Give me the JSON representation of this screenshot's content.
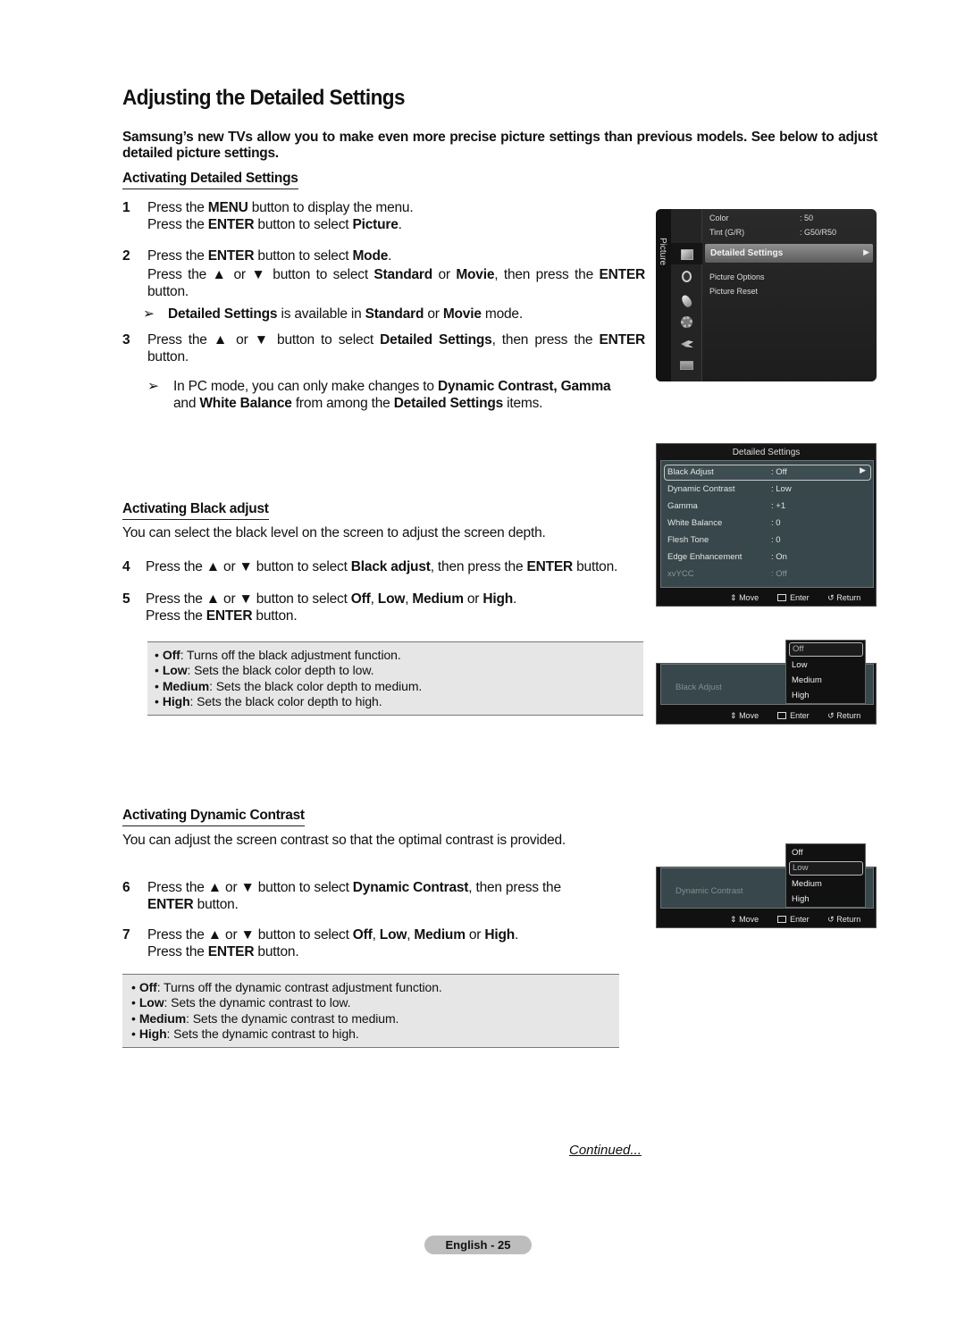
{
  "page": {
    "title": "Adjusting the Detailed Settings",
    "intro": "Samsung’s new TVs allow you to make even more precise picture settings than previous models. See below to adjust detailed picture settings.",
    "continued": "Continued...",
    "page_label": "English - 25"
  },
  "section1": {
    "heading": "Activating Detailed Settings",
    "step1": {
      "num": "1",
      "a": "Press the ",
      "b": "MENU",
      "c": " button to display the menu.",
      "d": "Press the ",
      "e": "ENTER",
      "f": " button to select ",
      "g": "Picture",
      "h": "."
    },
    "step2": {
      "num": "2",
      "a": "Press the ",
      "b": "ENTER",
      "c": " button to select ",
      "d": "Mode",
      "e": ".",
      "f": "Press the ▲ or ▼ button to select ",
      "g": "Standard",
      "h": " or ",
      "i": "Movie",
      "j": ", then press the ",
      "k": "ENTER",
      "l": " button."
    },
    "note1": {
      "arrow": "➢",
      "a": "Detailed Settings",
      "b": " is available in ",
      "c": "Standard",
      "d": " or ",
      "e": "Movie",
      "f": " mode."
    },
    "step3": {
      "num": "3",
      "a": "Press the ▲ or ▼ button to select ",
      "b": "Detailed Settings",
      "c": ", then press the ",
      "d": "ENTER",
      "e": " button."
    },
    "note2": {
      "arrow": "➢",
      "a": "In PC mode, you can only make changes to ",
      "b": "Dynamic Contrast, Gamma",
      "c": "and ",
      "d": "White Balance",
      "e": " from among the ",
      "f": "Detailed Settings",
      "g": " items."
    }
  },
  "section2": {
    "heading": "Activating Black adjust",
    "desc": "You can select the black level on the screen to adjust the screen depth.",
    "step4": {
      "num": "4",
      "a": "Press the ▲ or ▼ button to select ",
      "b": "Black adjust",
      "c": ", then press the ",
      "d": "ENTER",
      "e": " button."
    },
    "step5": {
      "num": "5",
      "a": "Press the ▲ or ▼ button to select ",
      "b": "Off",
      "c": ", ",
      "d": "Low",
      "e": ", ",
      "f": "Medium",
      "g": " or ",
      "h": "High",
      "i": ".",
      "j": "Press the ",
      "k": "ENTER",
      "l": " button."
    },
    "options": [
      {
        "name": "Off",
        "desc": ": Turns off the black adjustment function."
      },
      {
        "name": "Low",
        "desc": ": Sets the black color depth to low."
      },
      {
        "name": "Medium",
        "desc": ": Sets the black color depth to medium."
      },
      {
        "name": "High",
        "desc": ": Sets the black color depth to high."
      }
    ]
  },
  "section3": {
    "heading": "Activating Dynamic Contrast",
    "desc": "You can adjust the screen contrast so that the optimal contrast is provided.",
    "step6": {
      "num": "6",
      "a": "Press the ▲ or ▼ button to select ",
      "b": "Dynamic Contrast",
      "c": ", then press the",
      "d": "ENTER",
      "e": " button."
    },
    "step7": {
      "num": "7",
      "a": "Press the ▲ or ▼ button to select ",
      "b": "Off",
      "c": ", ",
      "d": "Low",
      "e": ", ",
      "f": "Medium",
      "g": " or ",
      "h": "High",
      "i": ".",
      "j": "Press the ",
      "k": "ENTER",
      "l": " button."
    },
    "options": [
      {
        "name": "Off",
        "desc": ": Turns off the dynamic contrast adjustment function."
      },
      {
        "name": "Low",
        "desc": ": Sets the dynamic contrast to low."
      },
      {
        "name": "Medium",
        "desc": ": Sets the dynamic contrast to medium."
      },
      {
        "name": "High",
        "desc": ": Sets the dynamic contrast to high."
      }
    ]
  },
  "osd_picture_menu": {
    "tab_label": "Picture",
    "icons": [
      "picture-icon",
      "sound-icon",
      "channel-icon",
      "setup-icon",
      "input-icon",
      "application-icon"
    ],
    "items": [
      {
        "label": "Color",
        "value": ": 50"
      },
      {
        "label": "Tint (G/R)",
        "value": ": G50/R50"
      },
      {
        "label": "Detailed Settings",
        "value": "▶",
        "selected": true
      },
      {
        "label": "Picture Options",
        "value": ""
      },
      {
        "label": "Picture Reset",
        "value": ""
      }
    ]
  },
  "osd_detailed_settings": {
    "title": "Detailed Settings",
    "items": [
      {
        "label": "Black Adjust",
        "value": ": Off",
        "selected": true,
        "arrow": "▶"
      },
      {
        "label": "Dynamic Contrast",
        "value": ": Low"
      },
      {
        "label": "Gamma",
        "value": ": +1"
      },
      {
        "label": "White Balance",
        "value": ": 0"
      },
      {
        "label": "Flesh Tone",
        "value": ": 0"
      },
      {
        "label": "Edge Enhancement",
        "value": ": On"
      },
      {
        "label": "xvYCC",
        "value": ": Off",
        "disabled": true
      }
    ]
  },
  "osd_footer": {
    "move": "Move",
    "enter": "Enter",
    "return": "Return",
    "move_icon": "⇕",
    "return_icon": "↺"
  },
  "osd_black_adjust": {
    "label": "Black Adjust",
    "colon": ":",
    "options": [
      "Off",
      "Low",
      "Medium",
      "High"
    ],
    "current": "Off"
  },
  "osd_dynamic_contrast": {
    "label": "Dynamic Contrast",
    "colon": ":",
    "options": [
      "Off",
      "Low",
      "Medium",
      "High"
    ],
    "current": "Low"
  }
}
